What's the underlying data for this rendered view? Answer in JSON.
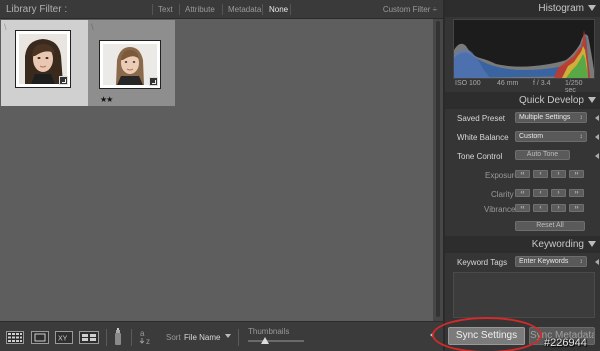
{
  "filter_bar": {
    "title": "Library Filter :",
    "tabs": [
      "Text",
      "Attribute",
      "Metadata",
      "None"
    ],
    "active_tab": "None",
    "custom_filter": "Custom Filter ÷"
  },
  "grid": {
    "cells": [
      {
        "selected": true,
        "rating": 0,
        "stars": ""
      },
      {
        "selected": false,
        "rating": 2,
        "stars": "★★"
      }
    ]
  },
  "toolbar": {
    "sort_label": "Sort",
    "sort_value": "File Name",
    "thumbnails_label": "Thumbnails",
    "icons": [
      "grid-view-icon",
      "loupe-view-icon",
      "compare-view-icon",
      "survey-view-icon",
      "spray-can-icon",
      "sort-az-icon"
    ]
  },
  "histogram": {
    "title": "Histogram",
    "iso": "ISO 100",
    "focal": "46 mm",
    "aperture": "f / 3.4",
    "shutter": "1/250 sec"
  },
  "quick_develop": {
    "title": "Quick Develop",
    "saved_preset_label": "Saved Preset",
    "saved_preset_value": "Multiple Settings",
    "white_balance_label": "White Balance",
    "white_balance_value": "Custom",
    "tone_control_label": "Tone Control",
    "auto_tone_label": "Auto Tone",
    "exposure_label": "Exposure",
    "clarity_label": "Clarity",
    "vibrance_label": "Vibrance",
    "reset_all_label": "Reset All"
  },
  "keywording": {
    "title": "Keywording",
    "keyword_tags_label": "Keyword Tags",
    "keyword_tags_value": "Enter Keywords"
  },
  "sync": {
    "settings_label": "Sync Settings",
    "metadata_label": "Sync Metadata"
  },
  "watermark": "#226944",
  "colors": {
    "annotation_oval": "#d32a2a"
  }
}
